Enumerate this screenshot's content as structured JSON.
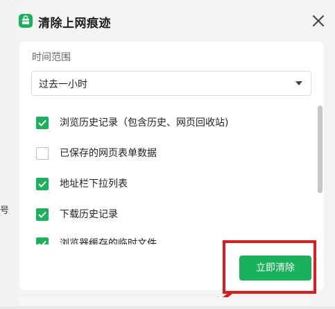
{
  "dialog": {
    "title": "清除上网痕迹",
    "app_icon": "clean-bag-icon",
    "close_icon": "close-icon"
  },
  "time_range": {
    "label": "时间范围",
    "selected": "过去一小时"
  },
  "items": [
    {
      "label": "浏览历史记录（包含历史、网页回收站)",
      "checked": true
    },
    {
      "label": "已保存的网页表单数据",
      "checked": false
    },
    {
      "label": "地址栏下拉列表",
      "checked": true
    },
    {
      "label": "下载历史记录",
      "checked": true
    },
    {
      "label": "浏览器缓存的临时文件",
      "checked": true
    }
  ],
  "action": {
    "clear_label": "立即清除"
  },
  "background": {
    "edge_char": "号"
  },
  "colors": {
    "accent": "#19b25a",
    "highlight": "#e1191b"
  }
}
